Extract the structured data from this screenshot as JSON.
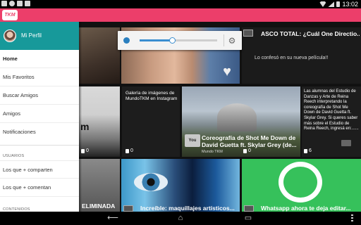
{
  "status_bar": {
    "time": "13:02"
  },
  "app": {
    "logo_text": "TKM"
  },
  "drawer": {
    "profile_name": "Mi Perfil",
    "items_top": [
      {
        "label": "Home"
      },
      {
        "label": "Mis Favoritos"
      },
      {
        "label": "Buscar Amigos"
      },
      {
        "label": "Amigos"
      },
      {
        "label": "Notificaciones"
      }
    ],
    "section_users": "USUARIOS",
    "items_users": [
      {
        "label": "Los que + comparten"
      },
      {
        "label": "Los que + comentan"
      }
    ],
    "section_content": "CONTENIDOS"
  },
  "volume": {
    "level_fraction": 0.42
  },
  "tiles": {
    "asco_title": "ASCO TOTAL: ¿Cuál One Directio...",
    "asco_sub": "Lo confesó en su nueva película!!",
    "gallery_text": "Galería de imágenes de MundoTKM en Instagram",
    "gallery_count": "0",
    "coreo_title": "Coreografía de Shot Me Down de David Guetta ft. Skylar Grey (de...",
    "coreo_source": "Mundo TKM",
    "coreo_count": "0",
    "alumnas_text": "Las alumnas del Estudio de Danzas y Arte de Reina Reech interpretando la coreografía de Shot Me Down de David Guetta ft. Skylar Grey. Si queres saber más sobre el Estudio de Reina Reech, ingresá en:......",
    "alumnas_count": "6",
    "left_mid_text": "m",
    "left_mid_count": "0",
    "eliminada_title": "ELIMINADA",
    "maquillajes_title": "Increíble: maquillajes artísticos...",
    "whatsapp_title": "Whatsapp ahora te deja editar..."
  },
  "colors": {
    "app_bar": "#ec3e6a",
    "drawer_header": "#17999a",
    "accent_blue": "#3a8ed0"
  }
}
